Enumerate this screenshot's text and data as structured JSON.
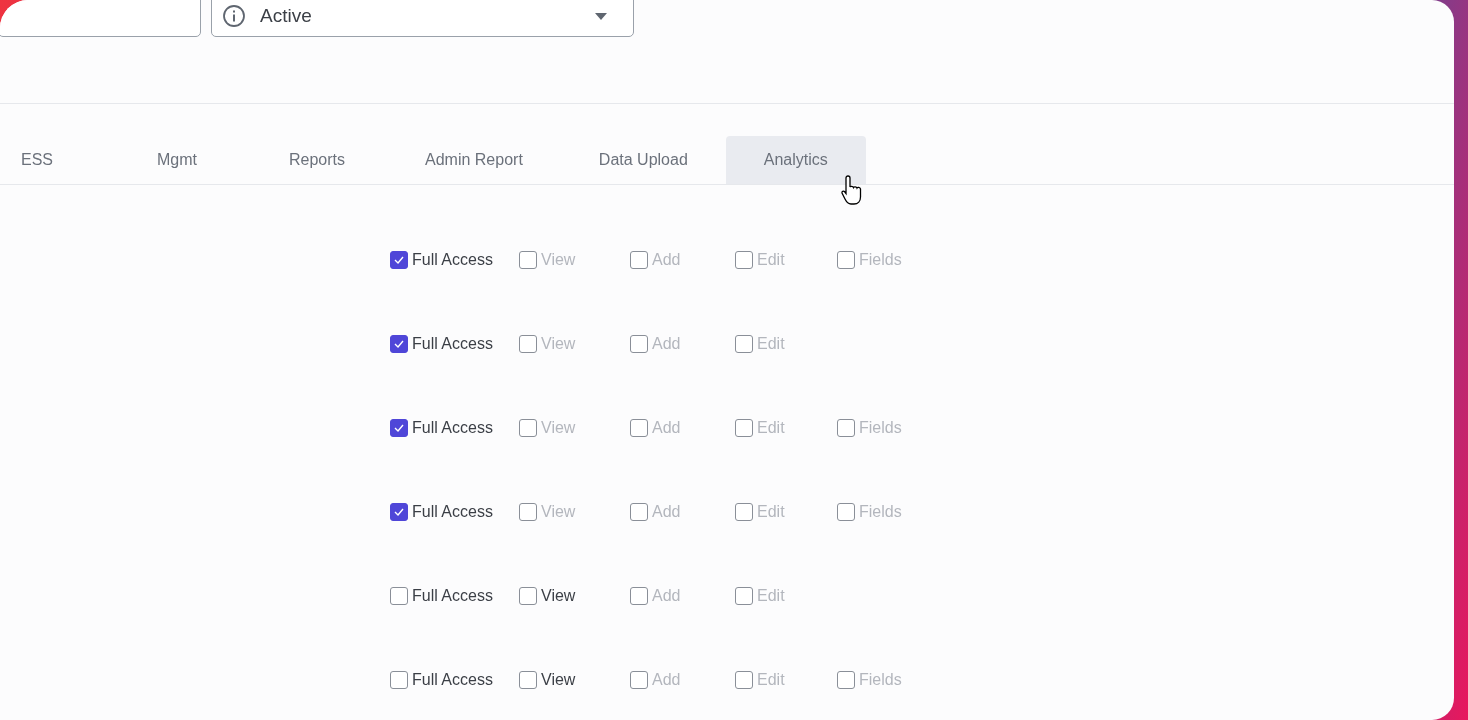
{
  "status_select": {
    "value": "Active"
  },
  "tabs": [
    {
      "label": "ESS",
      "selected": false
    },
    {
      "label": "Mgmt",
      "selected": false
    },
    {
      "label": "Reports",
      "selected": false
    },
    {
      "label": "Admin Report",
      "selected": false
    },
    {
      "label": "Data Upload",
      "selected": false
    },
    {
      "label": "Analytics",
      "selected": true
    }
  ],
  "permission_rows": [
    {
      "options": [
        {
          "label": "Full Access",
          "checked": true,
          "disabled": false
        },
        {
          "label": "View",
          "checked": false,
          "disabled": true
        },
        {
          "label": "Add",
          "checked": false,
          "disabled": true
        },
        {
          "label": "Edit",
          "checked": false,
          "disabled": true
        },
        {
          "label": "Fields",
          "checked": false,
          "disabled": true
        }
      ]
    },
    {
      "options": [
        {
          "label": "Full Access",
          "checked": true,
          "disabled": false
        },
        {
          "label": "View",
          "checked": false,
          "disabled": true
        },
        {
          "label": "Add",
          "checked": false,
          "disabled": true
        },
        {
          "label": "Edit",
          "checked": false,
          "disabled": true
        }
      ]
    },
    {
      "options": [
        {
          "label": "Full Access",
          "checked": true,
          "disabled": false
        },
        {
          "label": "View",
          "checked": false,
          "disabled": true
        },
        {
          "label": "Add",
          "checked": false,
          "disabled": true
        },
        {
          "label": "Edit",
          "checked": false,
          "disabled": true
        },
        {
          "label": "Fields",
          "checked": false,
          "disabled": true
        }
      ]
    },
    {
      "options": [
        {
          "label": "Full Access",
          "checked": true,
          "disabled": false
        },
        {
          "label": "View",
          "checked": false,
          "disabled": true
        },
        {
          "label": "Add",
          "checked": false,
          "disabled": true
        },
        {
          "label": "Edit",
          "checked": false,
          "disabled": true
        },
        {
          "label": "Fields",
          "checked": false,
          "disabled": true
        }
      ]
    },
    {
      "options": [
        {
          "label": "Full Access",
          "checked": false,
          "disabled": false
        },
        {
          "label": "View",
          "checked": false,
          "disabled": false
        },
        {
          "label": "Add",
          "checked": false,
          "disabled": true
        },
        {
          "label": "Edit",
          "checked": false,
          "disabled": true
        }
      ]
    },
    {
      "options": [
        {
          "label": "Full Access",
          "checked": false,
          "disabled": false
        },
        {
          "label": "View",
          "checked": false,
          "disabled": false
        },
        {
          "label": "Add",
          "checked": false,
          "disabled": true
        },
        {
          "label": "Edit",
          "checked": false,
          "disabled": true
        },
        {
          "label": "Fields",
          "checked": false,
          "disabled": true
        }
      ]
    }
  ]
}
